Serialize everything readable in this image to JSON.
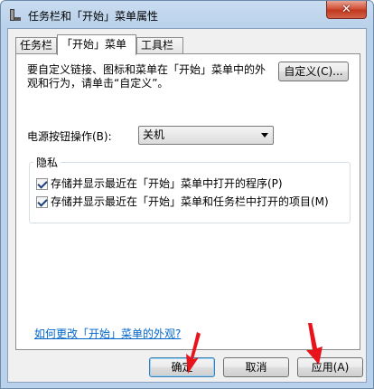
{
  "window": {
    "title": "任务栏和「开始」菜单属性",
    "close_glyph": "✕"
  },
  "tabs": [
    {
      "label": "任务栏"
    },
    {
      "label": "「开始」菜单"
    },
    {
      "label": "工具栏"
    }
  ],
  "start_menu": {
    "description": "要自定义链接、图标和菜单在「开始」菜单中的外观和行为，请单击“自定义”。",
    "customize_button": "自定义(C)...",
    "power_label": "电源按钮操作(B):",
    "power_value": "关机",
    "privacy": {
      "title": "隐私",
      "items": [
        {
          "label": "存储并显示最近在「开始」菜单中打开的程序(P)",
          "checked": true
        },
        {
          "label": "存储并显示最近在「开始」菜单和任务栏中打开的项目(M)",
          "checked": true
        }
      ]
    },
    "help_link": "如何更改「开始」菜单的外观?"
  },
  "footer": {
    "ok": "确定",
    "cancel": "取消",
    "apply": "应用(A)"
  },
  "annotation_color": "#e8141b"
}
